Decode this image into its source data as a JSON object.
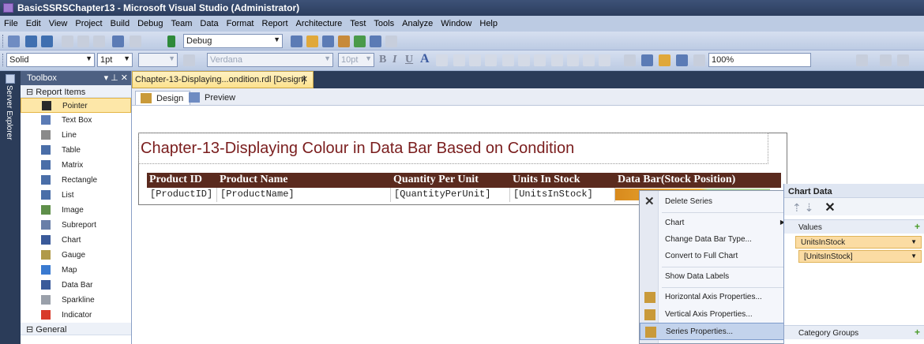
{
  "window": {
    "title": "BasicSSRSChapter13 - Microsoft Visual Studio (Administrator)"
  },
  "menu": [
    "File",
    "Edit",
    "View",
    "Project",
    "Build",
    "Debug",
    "Team",
    "Data",
    "Format",
    "Report",
    "Architecture",
    "Test",
    "Tools",
    "Analyze",
    "Window",
    "Help"
  ],
  "toolbar": {
    "config": "Debug",
    "line_style": "Solid",
    "line_width": "1pt",
    "font_name": "Verdana",
    "font_size": "10pt",
    "bold": "B",
    "italic": "I",
    "underline": "U",
    "font_color": "A",
    "zoom": "100%"
  },
  "server_explorer": {
    "label": "Server Explorer"
  },
  "toolbox": {
    "title": "Toolbox",
    "controls": "▾ ⊥ ✕",
    "group_report_items": "⊟ Report Items",
    "group_general": "⊟ General",
    "items": [
      {
        "label": "Pointer",
        "icon": "pointer-icon",
        "color": "#2a2a2a"
      },
      {
        "label": "Text Box",
        "icon": "textbox-icon",
        "color": "#5b7bb5"
      },
      {
        "label": "Line",
        "icon": "line-icon",
        "color": "#8a8a8a"
      },
      {
        "label": "Table",
        "icon": "table-icon",
        "color": "#4a6ea8"
      },
      {
        "label": "Matrix",
        "icon": "matrix-icon",
        "color": "#4a6ea8"
      },
      {
        "label": "Rectangle",
        "icon": "rectangle-icon",
        "color": "#4a6ea8"
      },
      {
        "label": "List",
        "icon": "list-icon",
        "color": "#4a6ea8"
      },
      {
        "label": "Image",
        "icon": "image-icon",
        "color": "#5f8f4a"
      },
      {
        "label": "Subreport",
        "icon": "subreport-icon",
        "color": "#6a7fa8"
      },
      {
        "label": "Chart",
        "icon": "chart-icon",
        "color": "#3a5a9a"
      },
      {
        "label": "Gauge",
        "icon": "gauge-icon",
        "color": "#b09a4a"
      },
      {
        "label": "Map",
        "icon": "map-icon",
        "color": "#3a7ad0"
      },
      {
        "label": "Data Bar",
        "icon": "databar-icon",
        "color": "#3a5a9a"
      },
      {
        "label": "Sparkline",
        "icon": "sparkline-icon",
        "color": "#9aa0aa"
      },
      {
        "label": "Indicator",
        "icon": "indicator-icon",
        "color": "#d83a2a"
      }
    ]
  },
  "document": {
    "tab_title": "Chapter-13-Displaying...ondition.rdl [Design]",
    "tab_close": "✕",
    "subtabs": [
      "Design",
      "Preview"
    ]
  },
  "report": {
    "title": "Chapter-13-Displaying Colour in Data Bar Based on Condition",
    "headers": [
      "Product ID",
      "Product Name",
      "Quantity Per Unit",
      "Units In Stock",
      "Data Bar(Stock Position)"
    ],
    "row": [
      "[ProductID]",
      "[ProductName]",
      "[QuantityPerUnit]",
      "[UnitsInStock]"
    ]
  },
  "context_menu": {
    "items": [
      {
        "label": "Delete Series"
      },
      {
        "label": "Chart"
      },
      {
        "label": "Change Data Bar Type..."
      },
      {
        "label": "Convert to Full Chart"
      },
      {
        "label": "Show Data Labels"
      },
      {
        "label": "Horizontal Axis Properties..."
      },
      {
        "label": "Vertical Axis Properties..."
      },
      {
        "label": "Series Properties..."
      }
    ]
  },
  "chart_data_panel": {
    "title": "Chart Data",
    "values_section": "Values",
    "value_series": "UnitsInStock",
    "value_field": "[UnitsInStock]",
    "category_section": "Category Groups"
  }
}
